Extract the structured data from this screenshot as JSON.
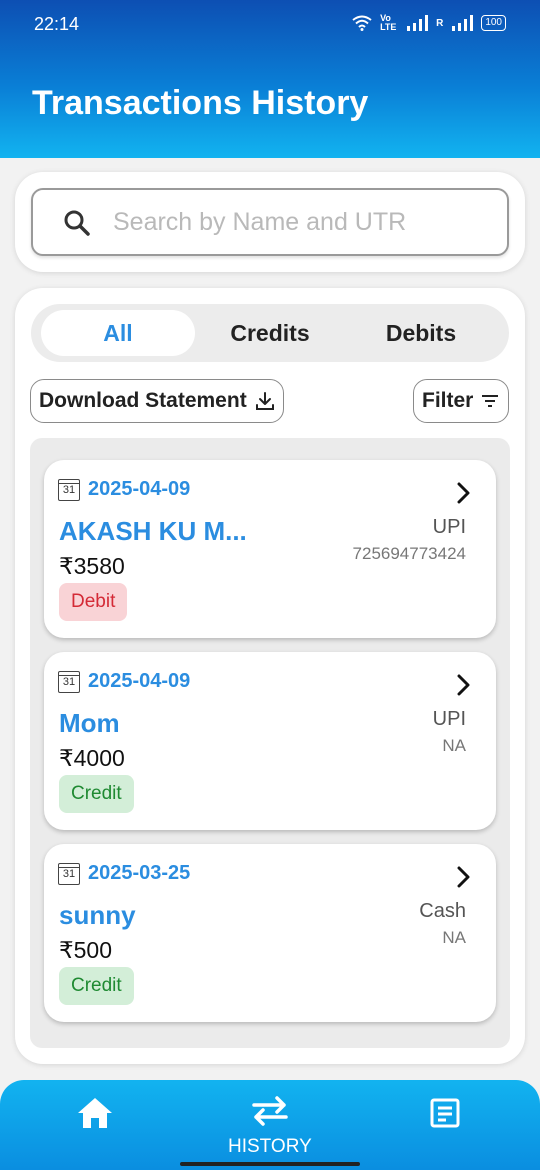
{
  "status_bar": {
    "time": "22:14",
    "volte_label": "Vo LTE",
    "roaming_label": "R",
    "battery": "100"
  },
  "header": {
    "title": "Transactions History"
  },
  "search": {
    "placeholder": "Search by Name and UTR",
    "value": ""
  },
  "tabs": [
    {
      "label": "All",
      "active": true
    },
    {
      "label": "Credits",
      "active": false
    },
    {
      "label": "Debits",
      "active": false
    }
  ],
  "actions": {
    "download_label": "Download Statement",
    "filter_label": "Filter"
  },
  "transactions": [
    {
      "date": "2025-04-09",
      "name": "AKASH KU M...",
      "amount": "₹3580",
      "mode": "UPI",
      "ref": "725694773424",
      "type": "Debit"
    },
    {
      "date": "2025-04-09",
      "name": "Mom",
      "amount": "₹4000",
      "mode": "UPI",
      "ref": "NA",
      "type": "Credit"
    },
    {
      "date": "2025-03-25",
      "name": "sunny",
      "amount": "₹500",
      "mode": "Cash",
      "ref": "NA",
      "type": "Credit"
    }
  ],
  "calendar_day": "31",
  "bottom_nav": {
    "history_label": "HISTORY"
  },
  "colors": {
    "accent": "#2b8de0",
    "debit_bg": "#f9d3d6",
    "debit_text": "#d42a36",
    "credit_bg": "#d3eed8",
    "credit_text": "#1f8a32"
  },
  "icons": [
    "wifi-icon",
    "signal-icon",
    "search-icon",
    "download-icon",
    "filter-icon",
    "calendar-icon",
    "chevron-right-icon",
    "home-icon",
    "swap-icon",
    "document-icon"
  ]
}
